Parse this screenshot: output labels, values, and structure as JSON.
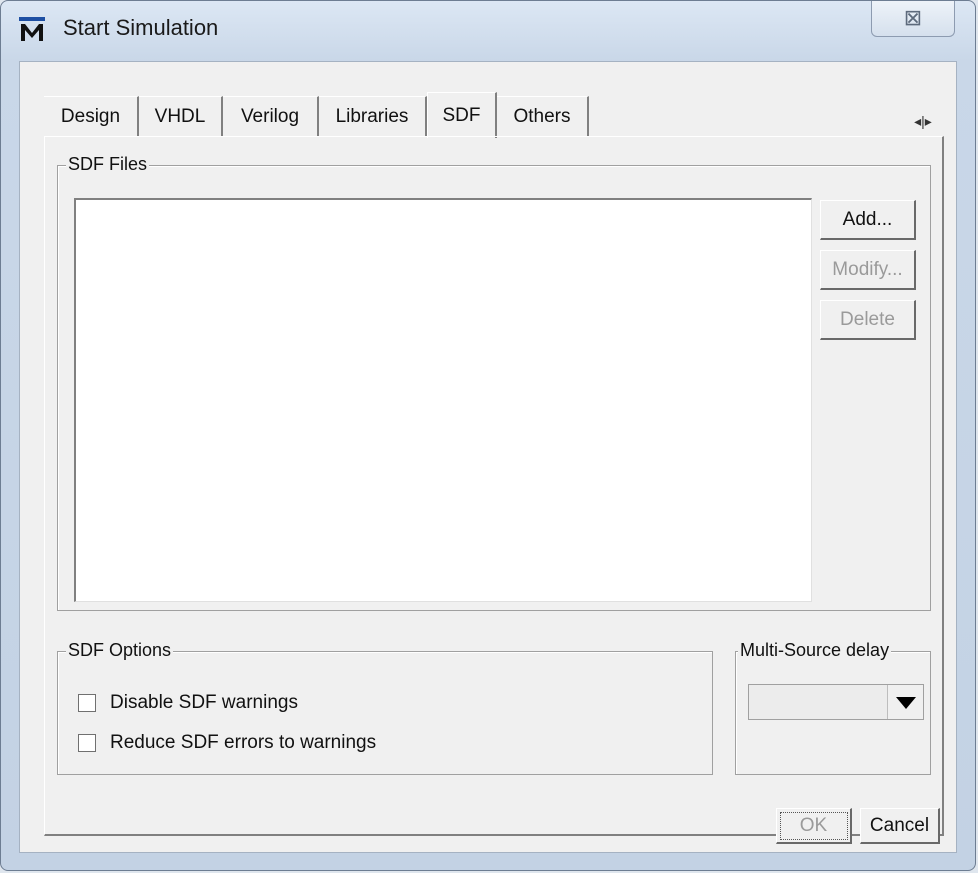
{
  "window": {
    "title": "Start Simulation",
    "close_glyph": "⊠"
  },
  "tabs": [
    {
      "label": "Design"
    },
    {
      "label": "VHDL"
    },
    {
      "label": "Verilog"
    },
    {
      "label": "Libraries"
    },
    {
      "label": "SDF",
      "active": true
    },
    {
      "label": "Others"
    }
  ],
  "tab_scroll_glyph": "◂|▸",
  "sdf_files": {
    "label": "SDF Files",
    "buttons": {
      "add": "Add...",
      "modify": "Modify...",
      "delete": "Delete"
    }
  },
  "sdf_options": {
    "label": "SDF Options",
    "disable_warnings": "Disable SDF warnings",
    "reduce_errors": "Reduce SDF errors to warnings"
  },
  "multi_source": {
    "label": "Multi-Source delay",
    "value": ""
  },
  "footer": {
    "ok": "OK",
    "cancel": "Cancel"
  }
}
